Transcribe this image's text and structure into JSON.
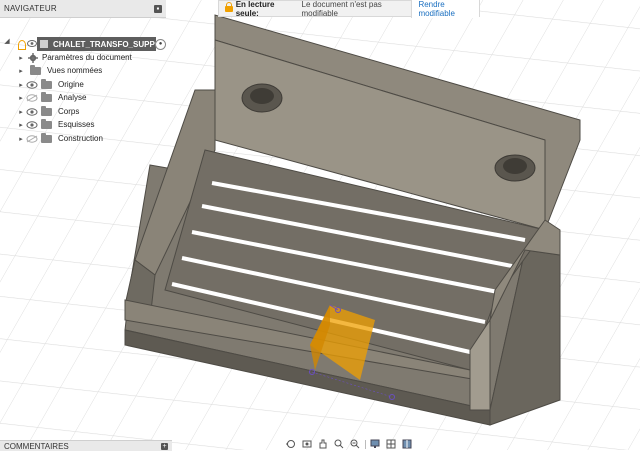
{
  "navigator": {
    "title": "NAVIGATEUR",
    "root": {
      "label": "CHALET_TRANSFO_SUPPOR..."
    },
    "items": [
      {
        "label": "Paramètres du document",
        "icon": "gear-icon"
      },
      {
        "label": "Vues nommées",
        "icon": "folder-icon"
      },
      {
        "label": "Origine",
        "icon": "folder-icon",
        "visible": true
      },
      {
        "label": "Analyse",
        "icon": "folder-icon",
        "visible": false
      },
      {
        "label": "Corps",
        "icon": "folder-icon",
        "visible": true
      },
      {
        "label": "Esquisses",
        "icon": "folder-icon",
        "visible": true
      },
      {
        "label": "Construction",
        "icon": "folder-icon",
        "visible": false
      }
    ]
  },
  "banner": {
    "label": "En lecture seule:",
    "message": "Le document n'est pas modifiable",
    "button": "Rendre modifiable"
  },
  "comments": {
    "title": "COMMENTAIRES"
  },
  "toolbar": {
    "tools": [
      "orbit-icon",
      "look-at-icon",
      "pan-icon",
      "zoom-icon",
      "fit-icon",
      "display-settings-icon",
      "grid-icon",
      "viewports-icon"
    ]
  },
  "colors": {
    "model": "#8a8478",
    "model_dark": "#5e5a52",
    "highlight": "#f0a000",
    "selection": "#1a6fc0"
  }
}
